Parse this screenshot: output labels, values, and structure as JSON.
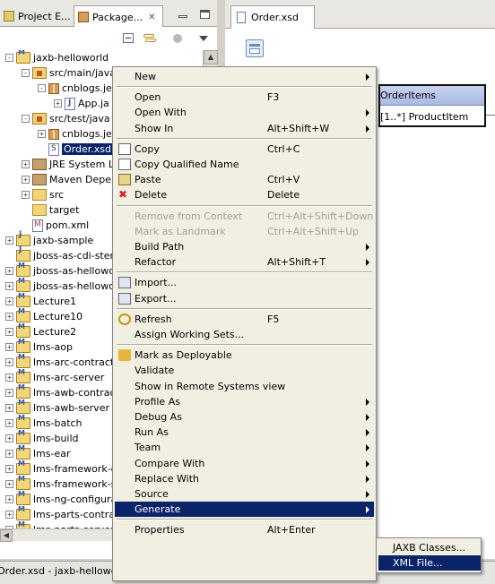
{
  "left_view": {
    "tabs": [
      {
        "label": "Project E..."
      },
      {
        "label": "Package...",
        "close": "✕"
      }
    ],
    "tree": [
      {
        "label": "jaxb-helloworld",
        "indent": 0,
        "icon": "maven-project-icon",
        "expander": "-"
      },
      {
        "label": "src/main/java",
        "indent": 1,
        "icon": "source-folder-icon",
        "expander": "-"
      },
      {
        "label": "cnblogs.je",
        "indent": 2,
        "icon": "package-icon",
        "expander": "-"
      },
      {
        "label": "App.ja",
        "indent": 3,
        "icon": "java-file-icon",
        "expander": "+"
      },
      {
        "label": "src/test/java",
        "indent": 1,
        "icon": "source-folder-icon",
        "expander": "-"
      },
      {
        "label": "cnblogs.je",
        "indent": 2,
        "icon": "package-icon",
        "expander": "+"
      },
      {
        "label": "Order.xsd",
        "indent": 2,
        "icon": "xsd-file-icon",
        "expander": "",
        "selected": true
      },
      {
        "label": "JRE System L",
        "indent": 1,
        "icon": "library-icon",
        "expander": "+"
      },
      {
        "label": "Maven Deper",
        "indent": 1,
        "icon": "library-icon",
        "expander": "+"
      },
      {
        "label": "src",
        "indent": 1,
        "icon": "folder-icon",
        "expander": "+"
      },
      {
        "label": "target",
        "indent": 1,
        "icon": "folder-icon",
        "expander": ""
      },
      {
        "label": "pom.xml",
        "indent": 1,
        "icon": "pom-file-icon",
        "expander": ""
      },
      {
        "label": "jaxb-sample",
        "indent": 0,
        "icon": "java-project-icon",
        "expander": "+"
      },
      {
        "label": "jboss-as-cdi-stere",
        "indent": 0,
        "icon": "java-project-icon",
        "expander": ""
      },
      {
        "label": "jboss-as-hellowor",
        "indent": 0,
        "icon": "maven-project-icon",
        "expander": "+"
      },
      {
        "label": "jboss-as-hellowor",
        "indent": 0,
        "icon": "maven-project-icon",
        "expander": "+"
      },
      {
        "label": "Lecture1",
        "indent": 0,
        "icon": "maven-project-icon",
        "expander": "+"
      },
      {
        "label": "Lecture10",
        "indent": 0,
        "icon": "maven-project-icon",
        "expander": "+"
      },
      {
        "label": "Lecture2",
        "indent": 0,
        "icon": "maven-project-icon",
        "expander": "+"
      },
      {
        "label": "lms-aop",
        "indent": 0,
        "icon": "maven-project-icon",
        "expander": "+"
      },
      {
        "label": "lms-arc-contract",
        "indent": 0,
        "icon": "maven-project-icon",
        "expander": "+"
      },
      {
        "label": "lms-arc-server",
        "indent": 0,
        "icon": "maven-project-icon",
        "expander": "+"
      },
      {
        "label": "lms-awb-contract",
        "indent": 0,
        "icon": "maven-project-icon",
        "expander": "+"
      },
      {
        "label": "lms-awb-server",
        "indent": 0,
        "icon": "maven-project-icon",
        "expander": "+"
      },
      {
        "label": "lms-batch",
        "indent": 0,
        "icon": "maven-project-icon",
        "expander": "+"
      },
      {
        "label": "lms-build",
        "indent": 0,
        "icon": "maven-project-icon",
        "expander": "+"
      },
      {
        "label": "lms-ear",
        "indent": 0,
        "icon": "maven-project-icon",
        "expander": "+"
      },
      {
        "label": "lms-framework-co",
        "indent": 0,
        "icon": "maven-project-icon",
        "expander": "+"
      },
      {
        "label": "lms-framework-se",
        "indent": 0,
        "icon": "maven-project-icon",
        "expander": "+"
      },
      {
        "label": "lms-ng-configurat",
        "indent": 0,
        "icon": "maven-project-icon",
        "expander": "+"
      },
      {
        "label": "lms-parts-contrac",
        "indent": 0,
        "icon": "maven-project-icon",
        "expander": "+"
      },
      {
        "label": "lms-parts-server",
        "indent": 0,
        "icon": "maven-project-icon",
        "expander": "+"
      }
    ]
  },
  "editor": {
    "tab_label": "Order.xsd",
    "element_name": "OrderItems",
    "element_row": "[1..*]   ProductItem"
  },
  "status_bar": "Order.xsd - jaxb-helloworld/",
  "context_menu": {
    "items": [
      {
        "type": "item",
        "label": "New",
        "submenu": true
      },
      {
        "type": "sep"
      },
      {
        "type": "item",
        "label": "Open",
        "key": "F3"
      },
      {
        "type": "item",
        "label": "Open With",
        "submenu": true
      },
      {
        "type": "item",
        "label": "Show In",
        "key": "Alt+Shift+W",
        "submenu": true
      },
      {
        "type": "sep"
      },
      {
        "type": "item",
        "label": "Copy",
        "key": "Ctrl+C",
        "icon": "copy-icon"
      },
      {
        "type": "item",
        "label": "Copy Qualified Name",
        "icon": "copy-icon"
      },
      {
        "type": "item",
        "label": "Paste",
        "key": "Ctrl+V",
        "icon": "paste-icon"
      },
      {
        "type": "item",
        "label": "Delete",
        "key": "Delete",
        "icon": "delete-icon"
      },
      {
        "type": "sep"
      },
      {
        "type": "item",
        "label": "Remove from Context",
        "key": "Ctrl+Alt+Shift+Down",
        "disabled": true
      },
      {
        "type": "item",
        "label": "Mark as Landmark",
        "key": "Ctrl+Alt+Shift+Up",
        "disabled": true
      },
      {
        "type": "item",
        "label": "Build Path",
        "submenu": true
      },
      {
        "type": "item",
        "label": "Refactor",
        "key": "Alt+Shift+T",
        "submenu": true
      },
      {
        "type": "sep"
      },
      {
        "type": "item",
        "label": "Import...",
        "icon": "import-icon"
      },
      {
        "type": "item",
        "label": "Export...",
        "icon": "export-icon"
      },
      {
        "type": "sep"
      },
      {
        "type": "item",
        "label": "Refresh",
        "key": "F5",
        "icon": "refresh-icon"
      },
      {
        "type": "item",
        "label": "Assign Working Sets..."
      },
      {
        "type": "sep"
      },
      {
        "type": "item",
        "label": "Mark as Deployable",
        "icon": "deploy-icon"
      },
      {
        "type": "item",
        "label": "Validate"
      },
      {
        "type": "item",
        "label": "Show in Remote Systems view"
      },
      {
        "type": "item",
        "label": "Profile As",
        "submenu": true
      },
      {
        "type": "item",
        "label": "Debug As",
        "submenu": true
      },
      {
        "type": "item",
        "label": "Run As",
        "submenu": true
      },
      {
        "type": "item",
        "label": "Team",
        "submenu": true
      },
      {
        "type": "item",
        "label": "Compare With",
        "submenu": true
      },
      {
        "type": "item",
        "label": "Replace With",
        "submenu": true
      },
      {
        "type": "item",
        "label": "Source",
        "submenu": true
      },
      {
        "type": "item",
        "label": "Generate",
        "submenu": true,
        "highlighted": true
      },
      {
        "type": "sep"
      },
      {
        "type": "item",
        "label": "Properties",
        "key": "Alt+Enter"
      }
    ]
  },
  "generate_submenu": {
    "items": [
      {
        "label": "JAXB Classes..."
      },
      {
        "label": "XML File...",
        "highlighted": true
      }
    ]
  },
  "colors": {
    "selection": "#0a246a",
    "menu_bg": "#f1efe2",
    "element_header": "#aab8e3"
  }
}
